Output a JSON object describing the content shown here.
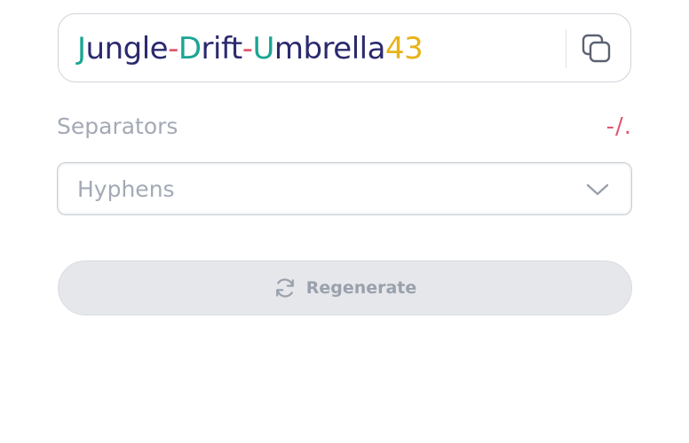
{
  "password": {
    "segments": [
      {
        "text": "J",
        "color": "#1aa593"
      },
      {
        "text": "ungle",
        "color": "#2b2a6e"
      },
      {
        "text": "-",
        "color": "#e0566f"
      },
      {
        "text": "D",
        "color": "#1aa593"
      },
      {
        "text": "rift",
        "color": "#2b2a6e"
      },
      {
        "text": "-",
        "color": "#e0566f"
      },
      {
        "text": "U",
        "color": "#1aa593"
      },
      {
        "text": "mbrella",
        "color": "#2b2a6e"
      },
      {
        "text": "43",
        "color": "#e8b317"
      }
    ],
    "copy_icon": "copy-icon"
  },
  "separators": {
    "label": "Separators",
    "hint": "-/.",
    "selected": "Hyphens",
    "chevron_icon": "chevron-down-icon"
  },
  "regenerate": {
    "label": "Regenerate",
    "icon": "refresh-icon"
  },
  "colors": {
    "accent_teal": "#1aa593",
    "text_navy": "#2b2a6e",
    "separator_red": "#e0566f",
    "number_yellow": "#e8b317",
    "muted_gray": "#a3aab5",
    "button_bg": "#e5e7eb"
  }
}
